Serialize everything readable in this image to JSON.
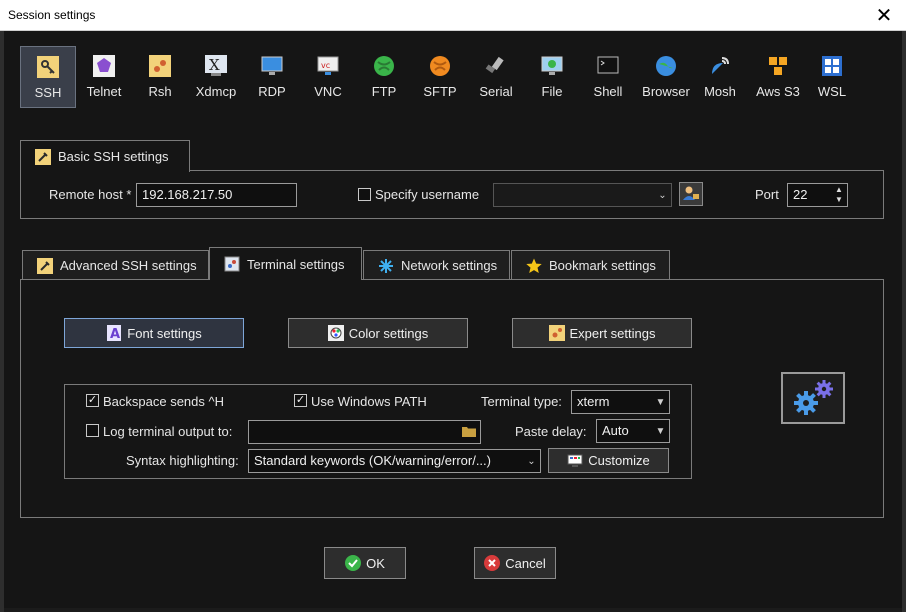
{
  "window": {
    "title": "Session settings"
  },
  "protocols": [
    {
      "label": "SSH",
      "icon": "ssh-key-icon",
      "selected": true
    },
    {
      "label": "Telnet",
      "icon": "telnet-icon"
    },
    {
      "label": "Rsh",
      "icon": "rsh-icon"
    },
    {
      "label": "Xdmcp",
      "icon": "xdmcp-icon"
    },
    {
      "label": "RDP",
      "icon": "rdp-monitor-icon"
    },
    {
      "label": "VNC",
      "icon": "vnc-icon"
    },
    {
      "label": "FTP",
      "icon": "ftp-globe-icon"
    },
    {
      "label": "SFTP",
      "icon": "sftp-globe-icon"
    },
    {
      "label": "Serial",
      "icon": "serial-plug-icon"
    },
    {
      "label": "File",
      "icon": "file-monitor-icon"
    },
    {
      "label": "Shell",
      "icon": "shell-terminal-icon"
    },
    {
      "label": "Browser",
      "icon": "browser-globe-icon"
    },
    {
      "label": "Mosh",
      "icon": "mosh-satellite-icon"
    },
    {
      "label": "Aws S3",
      "icon": "aws-s3-cubes-icon"
    },
    {
      "label": "WSL",
      "icon": "windows-logo-icon"
    }
  ],
  "basic": {
    "tab_label": "Basic SSH settings",
    "remote_host_label": "Remote host *",
    "remote_host_value": "192.168.217.50",
    "specify_username_label": "Specify username",
    "specify_username_checked": false,
    "username_value": "",
    "port_label": "Port",
    "port_value": "22"
  },
  "tabs": [
    {
      "label": "Advanced SSH settings",
      "icon": "wrench-icon"
    },
    {
      "label": "Terminal settings",
      "icon": "terminal-icon",
      "active": true
    },
    {
      "label": "Network settings",
      "icon": "network-icon"
    },
    {
      "label": "Bookmark settings",
      "icon": "star-icon"
    }
  ],
  "terminal": {
    "font_button": "Font settings",
    "color_button": "Color settings",
    "expert_button": "Expert settings",
    "backspace_label": "Backspace sends ^H",
    "backspace_checked": true,
    "windows_path_label": "Use Windows PATH",
    "windows_path_checked": true,
    "terminal_type_label": "Terminal type:",
    "terminal_type_value": "xterm",
    "log_label": "Log terminal output to:",
    "log_checked": false,
    "log_path_value": "",
    "paste_delay_label": "Paste delay:",
    "paste_delay_value": "Auto",
    "syntax_label": "Syntax highlighting:",
    "syntax_value": "Standard keywords (OK/warning/error/...)",
    "customize_button": "Customize"
  },
  "actions": {
    "ok": "OK",
    "cancel": "Cancel"
  },
  "colors": {
    "ok_green": "#3bb54a",
    "cancel_red": "#d83b3b",
    "gear_blue": "#4a9be8",
    "star_yellow": "#f5c518"
  }
}
